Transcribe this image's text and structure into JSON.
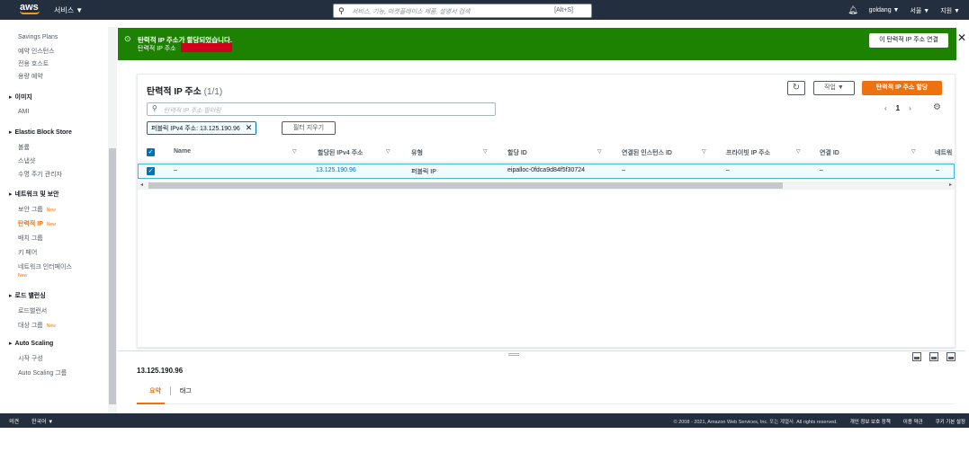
{
  "nav": {
    "logo": "aws",
    "services": "서비스 ▼",
    "search_placeholder": "서비스, 기능, 마켓플레이스 제품, 설명서 검색",
    "search_shortcut": "[Alt+S]",
    "user": "goldang ▼",
    "region": "서울 ▼",
    "support": "지원 ▼"
  },
  "sidebar": {
    "items": [
      {
        "label": "Savings Plans"
      },
      {
        "label": "예약 인스턴스"
      },
      {
        "label": "전용 호스트"
      },
      {
        "label": "용량 예약"
      }
    ],
    "sections": [
      {
        "label": "이미지",
        "items": [
          "AMI"
        ]
      },
      {
        "label": "Elastic Block Store",
        "items": [
          "볼륨",
          "스냅샷",
          "수명 주기 관리자"
        ]
      },
      {
        "label": "네트워크 및 보안",
        "items": [
          "보안 그룹",
          "탄력적 IP",
          "배치 그룹",
          "키 페어",
          "네트워크 인터페이스"
        ]
      },
      {
        "label": "로드 밸런싱",
        "items": [
          "로드밸런서",
          "대상 그룹"
        ]
      },
      {
        "label": "Auto Scaling",
        "items": [
          "시작 구성",
          "Auto Scaling 그룹"
        ]
      }
    ],
    "new_badge": "New"
  },
  "flash": {
    "title": "탄력적 IP 주소가 할당되었습니다.",
    "subtitle": "탄력적 IP 주소",
    "associate_button": "이 탄력적 IP 주소 연결",
    "dismiss": "✕"
  },
  "main": {
    "title": "탄력적 IP 주소",
    "count": "(1/1)",
    "actions_button": "작업 ▼",
    "allocate_button": "탄력적 IP 주소 할당",
    "filter_placeholder": "탄력적 IP 주소 필터링",
    "token": "퍼블릭 IPv4 주소: 13.125.190.96",
    "clear_button": "필터 지우기",
    "page": "1",
    "columns": [
      "Name",
      "할당된 IPv4 주소",
      "유형",
      "할당 ID",
      "연결된 인스턴스 ID",
      "프라이빗 IP 주소",
      "연결 ID",
      "네트워"
    ],
    "rows": [
      {
        "name": "–",
        "ipv4": "13.125.190.96",
        "type": "퍼블릭 IP",
        "allocation_id": "eipalloc-0fdca9d84f5f30724",
        "instance_id": "–",
        "private_ip": "–",
        "association_id": "–",
        "network": "–"
      }
    ]
  },
  "detail": {
    "title": "13.125.190.96",
    "tabs": [
      "요약",
      "태그"
    ]
  },
  "footer": {
    "feedback": "의견",
    "language": "한국어 ▼",
    "copyright": "© 2008 - 2021, Amazon Web Services, Inc. 또는 계열사. All rights reserved.",
    "privacy": "개인 정보 보호 정책",
    "terms": "이용 약관",
    "cookies": "쿠키 기본 설정"
  },
  "colors": {
    "nav_bg": "#232f3e",
    "success": "#1d8102",
    "accent": "#ec7211",
    "link": "#0073bb"
  }
}
